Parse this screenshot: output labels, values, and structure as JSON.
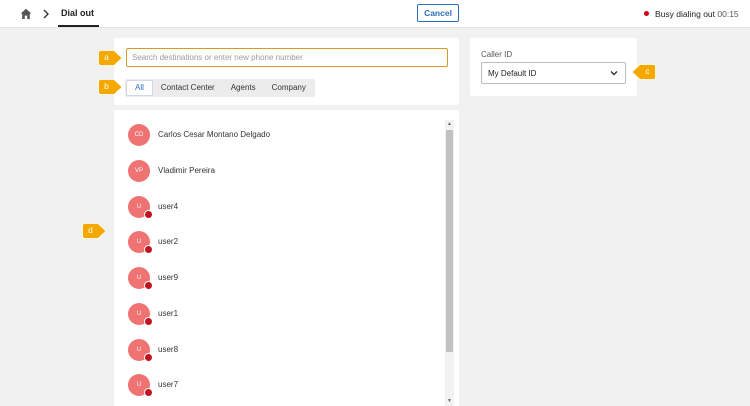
{
  "header": {
    "breadcrumb_title": "Dial out",
    "cancel_label": "Cancel",
    "status_text": "Busy dialing out",
    "status_timer": "00:15",
    "status_color": "#d0021b"
  },
  "search": {
    "placeholder": "Search destinations or enter new phone number",
    "value": ""
  },
  "tabs": [
    {
      "label": "All",
      "active": true
    },
    {
      "label": "Contact Center",
      "active": false
    },
    {
      "label": "Agents",
      "active": false
    },
    {
      "label": "Company",
      "active": false
    }
  ],
  "contacts": [
    {
      "initials": "CD",
      "name": "Carlos Cesar Montano Delgado",
      "presence": false
    },
    {
      "initials": "VP",
      "name": "Vladimir Pereira",
      "presence": false
    },
    {
      "initials": "U",
      "name": "user4",
      "presence": true
    },
    {
      "initials": "U",
      "name": "user2",
      "presence": true
    },
    {
      "initials": "U",
      "name": "user9",
      "presence": true
    },
    {
      "initials": "U",
      "name": "user1",
      "presence": true
    },
    {
      "initials": "U",
      "name": "user8",
      "presence": true
    },
    {
      "initials": "U",
      "name": "user7",
      "presence": true
    }
  ],
  "caller_id": {
    "label": "Caller ID",
    "selected": "My Default ID"
  },
  "callouts": {
    "a": "a",
    "b": "b",
    "c": "c",
    "d": "d",
    "color": "#f5a800"
  },
  "colors": {
    "accent": "#2c6fb6",
    "avatar": "#f07373",
    "presence_busy": "#c0131f"
  }
}
